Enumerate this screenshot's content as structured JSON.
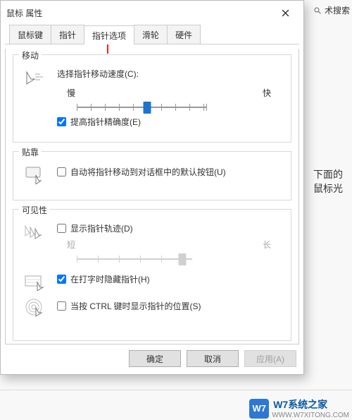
{
  "dialog": {
    "title": "鼠标 属性",
    "tabs": [
      {
        "label": "鼠标键",
        "active": false
      },
      {
        "label": "指针",
        "active": false
      },
      {
        "label": "指针选项",
        "active": true
      },
      {
        "label": "滑轮",
        "active": false
      },
      {
        "label": "硬件",
        "active": false
      }
    ],
    "groups": {
      "motion": {
        "title": "移动",
        "speed_label": "选择指针移动速度(C):",
        "slow": "慢",
        "fast": "快",
        "precision": {
          "label": "提高指针精确度(E)",
          "checked": true
        }
      },
      "snap": {
        "title": "贴靠",
        "snap_checkbox": {
          "label": "自动将指针移动到对话框中的默认按钮(U)",
          "checked": false
        }
      },
      "visibility": {
        "title": "可见性",
        "trails": {
          "label": "显示指针轨迹(D)",
          "checked": false
        },
        "trails_short": "短",
        "trails_long": "长",
        "hide_typing": {
          "label": "在打字时隐藏指针(H)",
          "checked": true
        },
        "ctrl_locate": {
          "label": "当按 CTRL 键时显示指针的位置(S)",
          "checked": false
        }
      }
    },
    "buttons": {
      "ok": "确定",
      "cancel": "取消",
      "apply": "应用(A)"
    }
  },
  "background": {
    "search_label": "术搜索",
    "side_text": "下面的鼠标光"
  },
  "watermark": {
    "logo": "W7",
    "text": "W7系统之家",
    "sub": "WWW.W7XITONG.COM"
  }
}
